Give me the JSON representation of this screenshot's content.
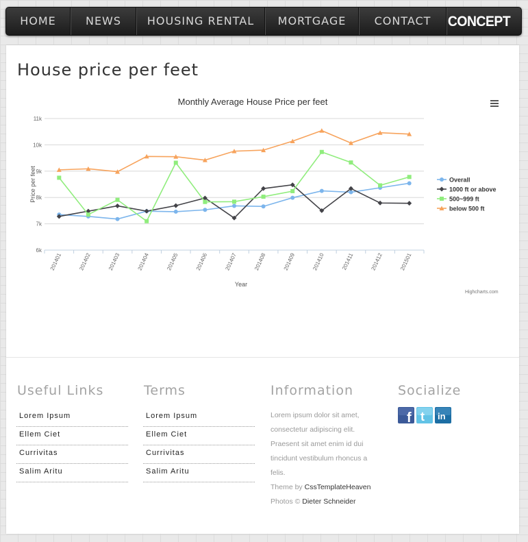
{
  "nav": {
    "items": [
      "HOME",
      "NEWS",
      "HOUSING RENTAL",
      "MORTGAGE",
      "CONTACT"
    ],
    "logo": "CONCEPT"
  },
  "page": {
    "title": "House price per feet"
  },
  "chart_data": {
    "type": "line",
    "title": "Monthly Average House Price per feet",
    "xlabel": "Year",
    "ylabel": "Price per feet",
    "categories": [
      "201401",
      "201402",
      "201403",
      "201404",
      "201405",
      "201406",
      "201407",
      "201408",
      "201409",
      "201410",
      "201411",
      "201412",
      "201501"
    ],
    "ylim": [
      6000,
      11000
    ],
    "yticks": [
      6000,
      7000,
      8000,
      9000,
      10000,
      11000
    ],
    "ytick_labels": [
      "6k",
      "7k",
      "8k",
      "9k",
      "10k",
      "11k"
    ],
    "grid": true,
    "legend_position": "right",
    "series": [
      {
        "name": "Overall",
        "color": "#7cb5ec",
        "marker": "circle",
        "values": [
          7350,
          7280,
          7180,
          7480,
          7460,
          7530,
          7680,
          7660,
          7990,
          8250,
          8200,
          8370,
          8540
        ]
      },
      {
        "name": "1000 ft or above",
        "color": "#434348",
        "marker": "diamond",
        "values": [
          7280,
          7480,
          7680,
          7480,
          7690,
          7980,
          7220,
          8340,
          8480,
          7500,
          8340,
          7790,
          7780
        ]
      },
      {
        "name": "500~999 ft",
        "color": "#90ed7d",
        "marker": "square",
        "values": [
          8750,
          7350,
          7910,
          7100,
          9320,
          7830,
          7840,
          8030,
          8240,
          9730,
          9330,
          8460,
          8780
        ]
      },
      {
        "name": "below 500 ft",
        "color": "#f7a35c",
        "marker": "triangle",
        "values": [
          9050,
          9090,
          8980,
          9560,
          9550,
          9420,
          9760,
          9800,
          10140,
          10540,
          10070,
          10460,
          10410
        ]
      }
    ],
    "credit": "Highcharts.com"
  },
  "footer": {
    "useful_links": {
      "title": "Useful Links",
      "items": [
        "Lorem Ipsum",
        "Ellem Ciet",
        "Currivitas",
        "Salim Aritu"
      ]
    },
    "terms": {
      "title": "Terms",
      "items": [
        "Lorem Ipsum",
        "Ellem Ciet",
        "Currivitas",
        "Salim Aritu"
      ]
    },
    "information": {
      "title": "Information",
      "text": "Lorem ipsum dolor sit amet, consectetur adipiscing elit. Praesent sit amet enim id dui tincidunt vestibulum rhoncus a felis.",
      "theme_prefix": "Theme by",
      "theme_author": "CssTemplateHeaven",
      "photos_prefix": "Photos ©",
      "photos_author": "Dieter Schneider"
    },
    "socialize": {
      "title": "Socialize",
      "icons": [
        "facebook-icon",
        "twitter-icon",
        "linkedin-icon"
      ]
    }
  }
}
